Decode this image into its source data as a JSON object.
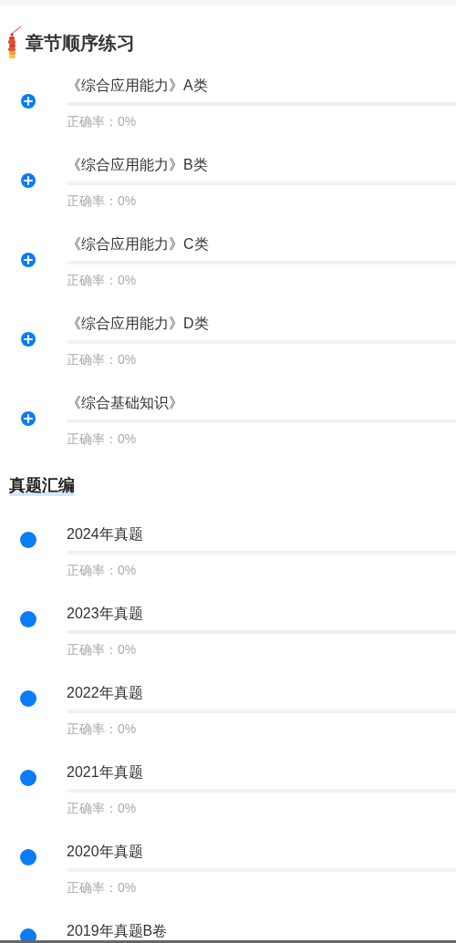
{
  "sections": [
    {
      "title": "章节顺序练习",
      "kind": "chapters",
      "items": [
        {
          "title": "《综合应用能力》A类",
          "accuracy": "正确率：0%",
          "level": 0
        },
        {
          "title": "《综合应用能力》B类",
          "accuracy": "正确率：0%",
          "level": 0
        },
        {
          "title": "《综合应用能力》C类",
          "accuracy": "正确率：0%",
          "level": 0
        },
        {
          "title": "《综合应用能力》D类",
          "accuracy": "正确率：0%",
          "level": 0
        },
        {
          "title": "《综合基础知识》",
          "accuracy": "正确率：0%",
          "level": 0
        }
      ]
    },
    {
      "title": "真题汇编",
      "kind": "papers",
      "items": [
        {
          "title": "2024年真题",
          "accuracy": "正确率：0%",
          "level": 0
        },
        {
          "title": "2023年真题",
          "accuracy": "正确率：0%",
          "level": 0
        },
        {
          "title": "2022年真题",
          "accuracy": "正确率：0%",
          "level": 0
        },
        {
          "title": "2021年真题",
          "accuracy": "正确率：0%",
          "level": 0
        },
        {
          "title": "2020年真题",
          "accuracy": "正确率：0%",
          "level": 0
        },
        {
          "title": "2019年真题B卷"
        }
      ]
    }
  ]
}
